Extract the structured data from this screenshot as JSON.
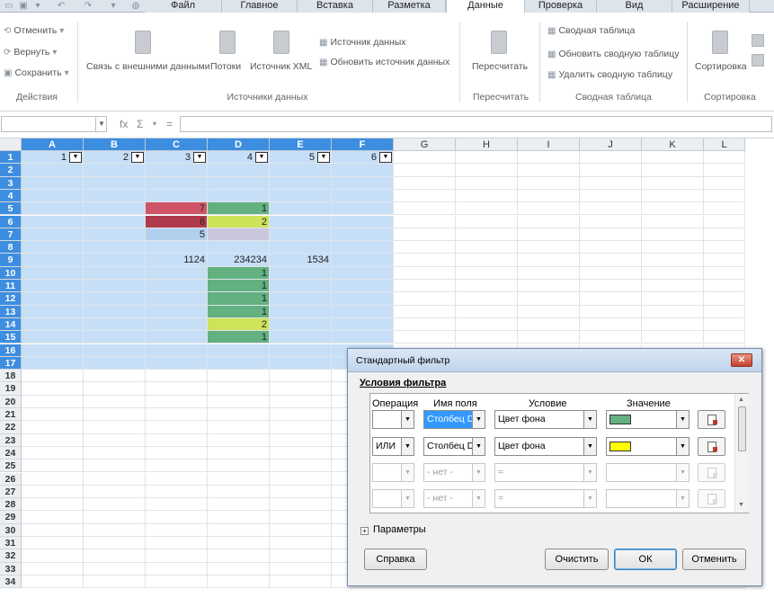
{
  "ribbon_tabs": [
    "Файл",
    "Главное",
    "Вставка",
    "Разметка",
    "Данные",
    "Проверка",
    "Вид",
    "Расширение"
  ],
  "ribbon": {
    "actions": {
      "undo": "Отменить",
      "redo": "Вернуть",
      "save": "Сохранить",
      "group": "Действия"
    },
    "sources": {
      "external": "Связь с внешними данными",
      "streams": "Потоки",
      "xml": "Источник XML",
      "datasource": "Источник данных",
      "refresh": "Обновить источник данных",
      "group": "Источники данных"
    },
    "recalc": {
      "button": "Пересчитать",
      "group": "Пересчитать"
    },
    "pivot": {
      "create": "Сводная таблица",
      "refresh": "Обновить сводную таблицу",
      "delete": "Удалить сводную таблицу",
      "group": "Сводная таблица"
    },
    "sort": {
      "button": "Сортировка",
      "group": "Сортировка"
    }
  },
  "formula": {
    "fx": "fx",
    "sum": "Σ",
    "eq": "="
  },
  "columns": [
    "A",
    "B",
    "C",
    "D",
    "E",
    "F",
    "G",
    "H",
    "I",
    "J",
    "K",
    "L"
  ],
  "rows": [
    "1",
    "2",
    "3",
    "4",
    "5",
    "6",
    "7",
    "8",
    "9",
    "10",
    "11",
    "12",
    "13",
    "14",
    "15",
    "16",
    "17",
    "18",
    "19",
    "20",
    "21",
    "22",
    "23",
    "24",
    "25",
    "26",
    "27",
    "28",
    "29",
    "30",
    "31",
    "32",
    "33",
    "34"
  ],
  "cells": [
    {
      "r": 1,
      "c": 0,
      "v": "1"
    },
    {
      "r": 1,
      "c": 1,
      "v": "2"
    },
    {
      "r": 1,
      "c": 2,
      "v": "3"
    },
    {
      "r": 1,
      "c": 3,
      "v": "4"
    },
    {
      "r": 1,
      "c": 4,
      "v": "5"
    },
    {
      "r": 1,
      "c": 5,
      "v": "6"
    },
    {
      "r": 5,
      "c": 2,
      "v": "7",
      "bg": "#cf5566"
    },
    {
      "r": 5,
      "c": 3,
      "v": "1",
      "bg": "#63b080"
    },
    {
      "r": 6,
      "c": 2,
      "v": "6",
      "bg": "#b03a4c"
    },
    {
      "r": 6,
      "c": 3,
      "v": "2",
      "bg": "#cfe35a"
    },
    {
      "r": 7,
      "c": 2,
      "v": "5",
      "bg": "#b3cfee"
    },
    {
      "r": 7,
      "c": 3,
      "v": "",
      "bg": "#c9c6de"
    },
    {
      "r": 9,
      "c": 2,
      "v": "1124"
    },
    {
      "r": 9,
      "c": 3,
      "v": "234234"
    },
    {
      "r": 9,
      "c": 4,
      "v": "1534"
    },
    {
      "r": 10,
      "c": 3,
      "v": "1",
      "bg": "#63b080"
    },
    {
      "r": 11,
      "c": 3,
      "v": "1",
      "bg": "#63b080"
    },
    {
      "r": 12,
      "c": 3,
      "v": "1",
      "bg": "#63b080"
    },
    {
      "r": 13,
      "c": 3,
      "v": "1",
      "bg": "#63b080"
    },
    {
      "r": 14,
      "c": 3,
      "v": "2",
      "bg": "#cfe35a"
    },
    {
      "r": 15,
      "c": 3,
      "v": "1",
      "bg": "#63b080"
    }
  ],
  "colors": {
    "selection": "#c6dff7",
    "header_selected": "#3d8ee0",
    "green": "#63b080",
    "yellow": "#ffff00"
  },
  "dialog": {
    "title": "Стандартный фильтр",
    "conditions_label": "Условия фильтра",
    "headers": {
      "operation": "Операция",
      "field": "Имя поля",
      "condition": "Условие",
      "value": "Значение"
    },
    "rows": [
      {
        "op": "",
        "field": "Столбец D",
        "cond": "Цвет фона",
        "value_color": "#63b080"
      },
      {
        "op": "ИЛИ",
        "field": "Столбец D",
        "cond": "Цвет фона",
        "value_color": "#ffff00"
      },
      {
        "op": "",
        "field": "- нет -",
        "cond": "=",
        "value_color": ""
      },
      {
        "op": "",
        "field": "- нет -",
        "cond": "=",
        "value_color": ""
      }
    ],
    "options_label": "Параметры",
    "help": "Справка",
    "clear": "Очистить",
    "ok": "ОК",
    "cancel": "Отменить"
  }
}
